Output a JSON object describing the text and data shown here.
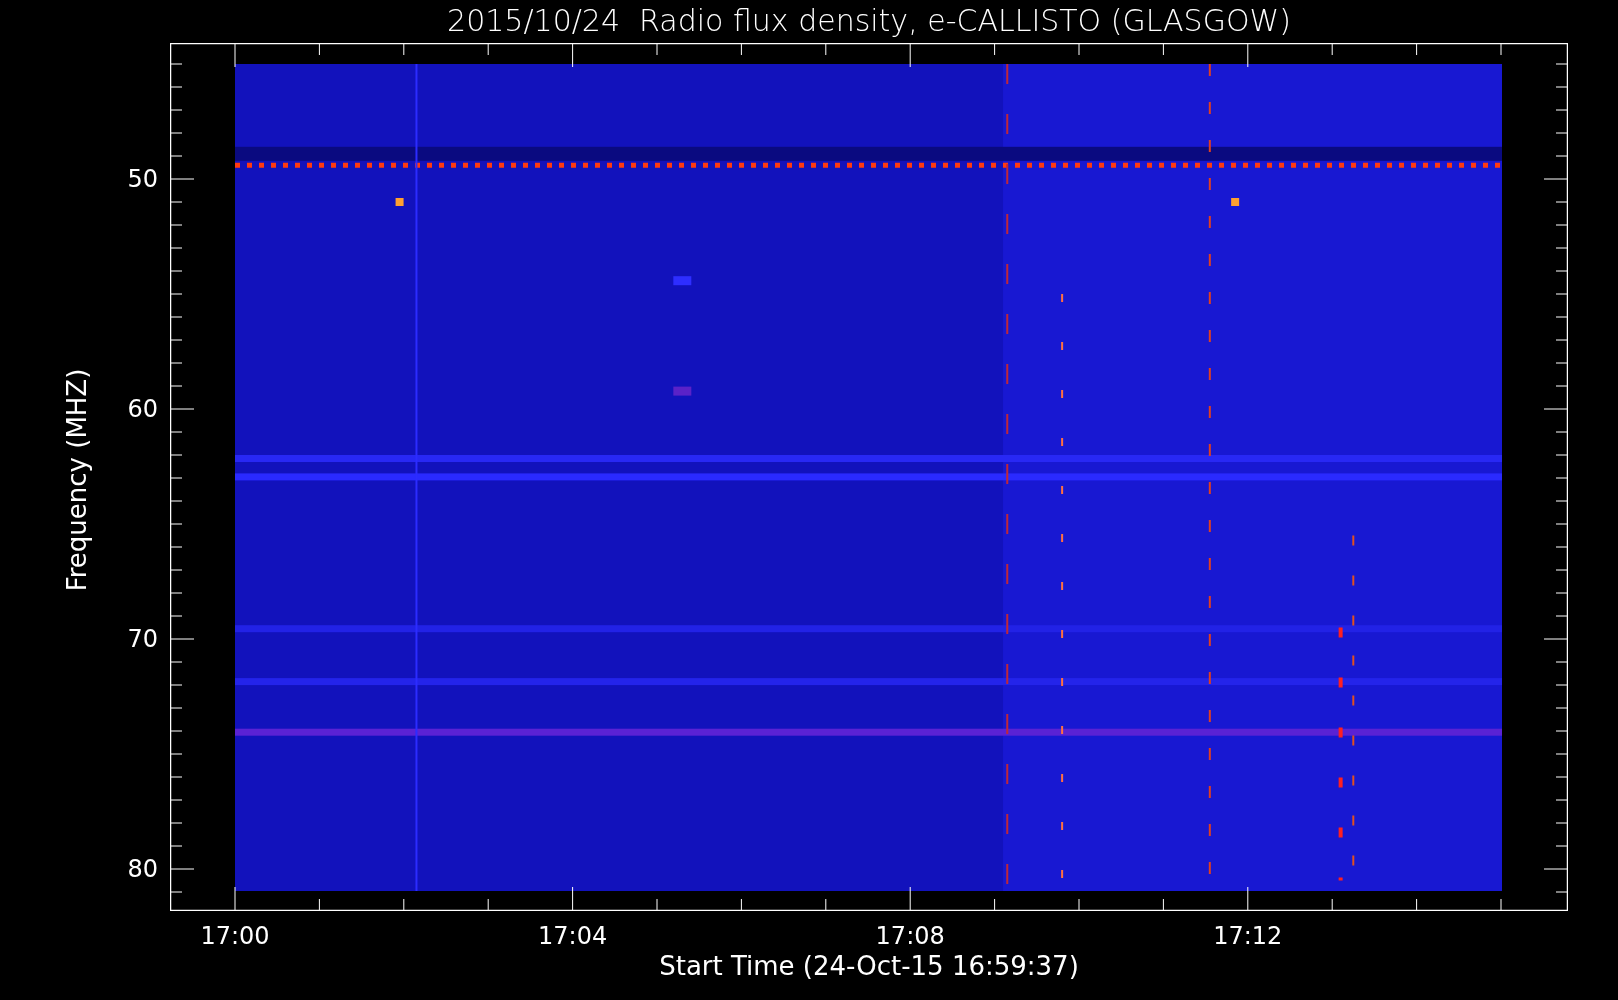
{
  "title": "2015/10/24  Radio flux density, e-CALLISTO (GLASGOW)",
  "y_axis": {
    "label": "Frequency (MHZ)",
    "ticks": [
      "50",
      "60",
      "70",
      "80"
    ]
  },
  "x_axis": {
    "label": "Start Time (24-Oct-15 16:59:37)",
    "ticks": [
      "17:00",
      "17:04",
      "17:08",
      "17:12"
    ]
  }
}
